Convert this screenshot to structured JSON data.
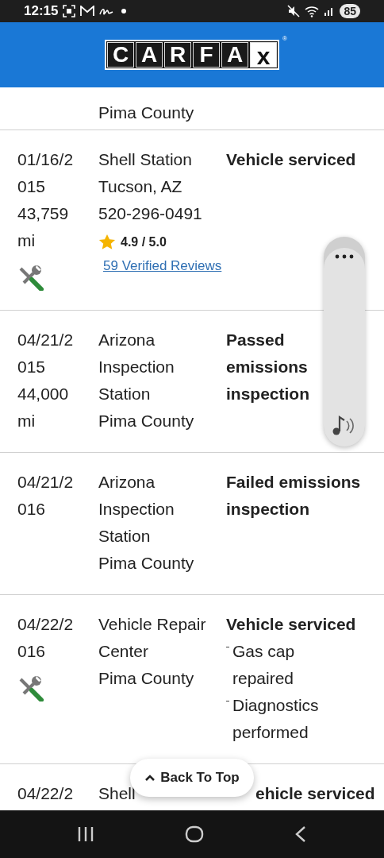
{
  "status_bar": {
    "time": "12:15",
    "battery": "85"
  },
  "header": {
    "logo_letters": [
      "C",
      "A",
      "R",
      "F",
      "A",
      "x"
    ],
    "registered": "®"
  },
  "records": [
    {
      "service_icon": false,
      "location": [
        "Pima County"
      ]
    },
    {
      "date": "01/16/2015",
      "mileage": "43,759 mi",
      "service_icon": true,
      "location": [
        "Shell Station",
        "Tucson, AZ",
        "520-296-0491"
      ],
      "rating": {
        "score": "4.9 / 5.0",
        "reviews": "59 Verified Reviews"
      },
      "title": "Vehicle serviced"
    },
    {
      "date": "04/21/2015",
      "mileage": "44,000 mi",
      "service_icon": false,
      "location": [
        "Arizona Inspection Station",
        "Pima County"
      ],
      "title": "Passed emissions inspection"
    },
    {
      "date": "04/21/2016",
      "service_icon": false,
      "location": [
        "Arizona Inspection Station",
        "Pima County"
      ],
      "title": "Failed emissions inspection"
    },
    {
      "date": "04/22/2016",
      "service_icon": true,
      "location": [
        "Vehicle Repair Center",
        "Pima County"
      ],
      "title": "Vehicle serviced",
      "items": [
        "Gas cap repaired",
        "Diagnostics performed"
      ]
    },
    {
      "date": "04/22/2",
      "service_icon": false,
      "location": [
        "Shell"
      ],
      "title": "ehicle serviced"
    }
  ],
  "back_to_top": "Back To Top"
}
